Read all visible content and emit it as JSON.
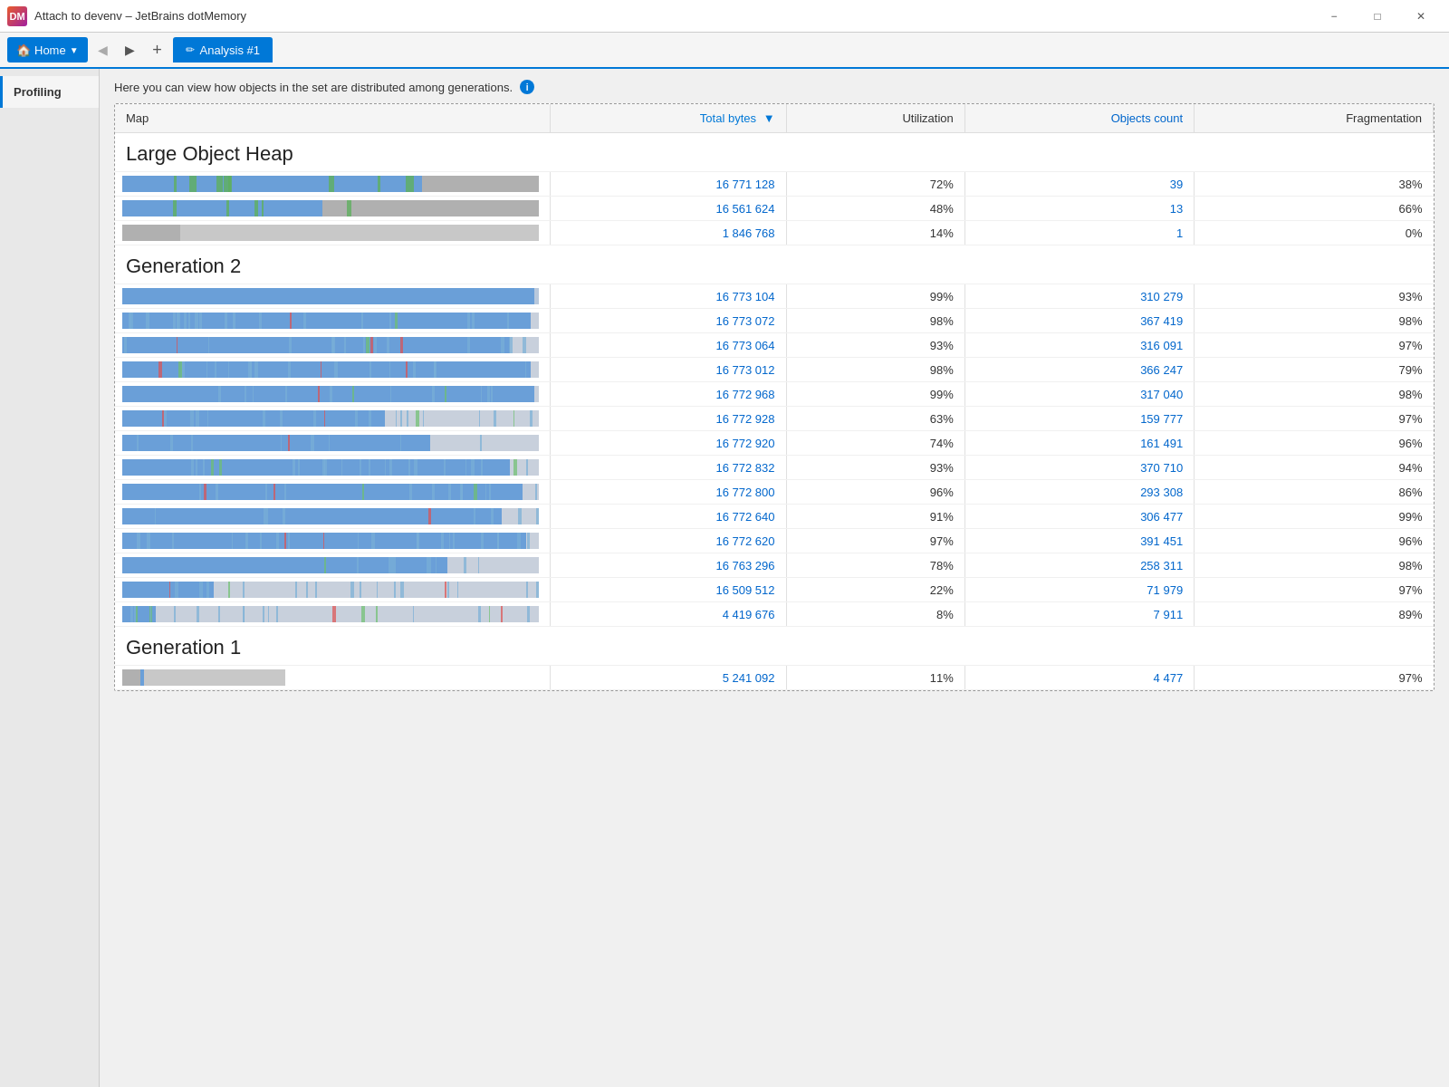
{
  "window": {
    "title": "Attach to devenv – JetBrains dotMemory",
    "minimize_label": "−",
    "maximize_label": "□",
    "close_label": "✕",
    "logo_text": "DM"
  },
  "toolbar": {
    "home_label": "Home",
    "back_label": "◀",
    "forward_label": "▶",
    "add_label": "+",
    "tab_label": "Analysis #1",
    "tab_icon": "✏"
  },
  "sidebar": {
    "items": [
      {
        "label": "Profiling",
        "active": true
      }
    ]
  },
  "info_text": "Here you can view how objects in the set are distributed among generations.",
  "table": {
    "columns": {
      "map": "Map",
      "total_bytes": "Total bytes",
      "utilization": "Utilization",
      "objects_count": "Objects count",
      "fragmentation": "Fragmentation"
    },
    "sections": [
      {
        "name": "Large Object Heap",
        "rows": [
          {
            "total_bytes": "16 771 128",
            "utilization": "72%",
            "objects_count": "39",
            "fragmentation": "38%",
            "bar_type": "loh1"
          },
          {
            "total_bytes": "16 561 624",
            "utilization": "48%",
            "objects_count": "13",
            "fragmentation": "66%",
            "bar_type": "loh2"
          },
          {
            "total_bytes": "1 846 768",
            "utilization": "14%",
            "objects_count": "1",
            "fragmentation": "0%",
            "bar_type": "loh3"
          }
        ]
      },
      {
        "name": "Generation 2",
        "rows": [
          {
            "total_bytes": "16 773 104",
            "utilization": "99%",
            "objects_count": "310 279",
            "fragmentation": "93%",
            "bar_type": "gen2_solid"
          },
          {
            "total_bytes": "16 773 072",
            "utilization": "98%",
            "objects_count": "367 419",
            "fragmentation": "98%",
            "bar_type": "gen2_stripe"
          },
          {
            "total_bytes": "16 773 064",
            "utilization": "93%",
            "objects_count": "316 091",
            "fragmentation": "97%",
            "bar_type": "gen2_dense"
          },
          {
            "total_bytes": "16 773 012",
            "utilization": "98%",
            "objects_count": "366 247",
            "fragmentation": "79%",
            "bar_type": "gen2_stripe2"
          },
          {
            "total_bytes": "16 772 968",
            "utilization": "99%",
            "objects_count": "317 040",
            "fragmentation": "98%",
            "bar_type": "gen2_stripe3"
          },
          {
            "total_bytes": "16 772 928",
            "utilization": "63%",
            "objects_count": "159 777",
            "fragmentation": "97%",
            "bar_type": "gen2_dense2"
          },
          {
            "total_bytes": "16 772 920",
            "utilization": "74%",
            "objects_count": "161 491",
            "fragmentation": "96%",
            "bar_type": "gen2_stripe4"
          },
          {
            "total_bytes": "16 772 832",
            "utilization": "93%",
            "objects_count": "370 710",
            "fragmentation": "94%",
            "bar_type": "gen2_stripe5"
          },
          {
            "total_bytes": "16 772 800",
            "utilization": "96%",
            "objects_count": "293 308",
            "fragmentation": "86%",
            "bar_type": "gen2_stripe6"
          },
          {
            "total_bytes": "16 772 640",
            "utilization": "91%",
            "objects_count": "306 477",
            "fragmentation": "99%",
            "bar_type": "gen2_stripe7"
          },
          {
            "total_bytes": "16 772 620",
            "utilization": "97%",
            "objects_count": "391 451",
            "fragmentation": "96%",
            "bar_type": "gen2_stripe8"
          },
          {
            "total_bytes": "16 763 296",
            "utilization": "78%",
            "objects_count": "258 311",
            "fragmentation": "98%",
            "bar_type": "gen2_stripe9"
          },
          {
            "total_bytes": "16 509 512",
            "utilization": "22%",
            "objects_count": "71 979",
            "fragmentation": "97%",
            "bar_type": "gen2_stripe10"
          },
          {
            "total_bytes": "4 419 676",
            "utilization": "8%",
            "objects_count": "7 911",
            "fragmentation": "89%",
            "bar_type": "gen2_small"
          }
        ]
      },
      {
        "name": "Generation 1",
        "rows": [
          {
            "total_bytes": "5 241 092",
            "utilization": "11%",
            "objects_count": "4 477",
            "fragmentation": "97%",
            "bar_type": "gen1"
          }
        ]
      }
    ]
  }
}
